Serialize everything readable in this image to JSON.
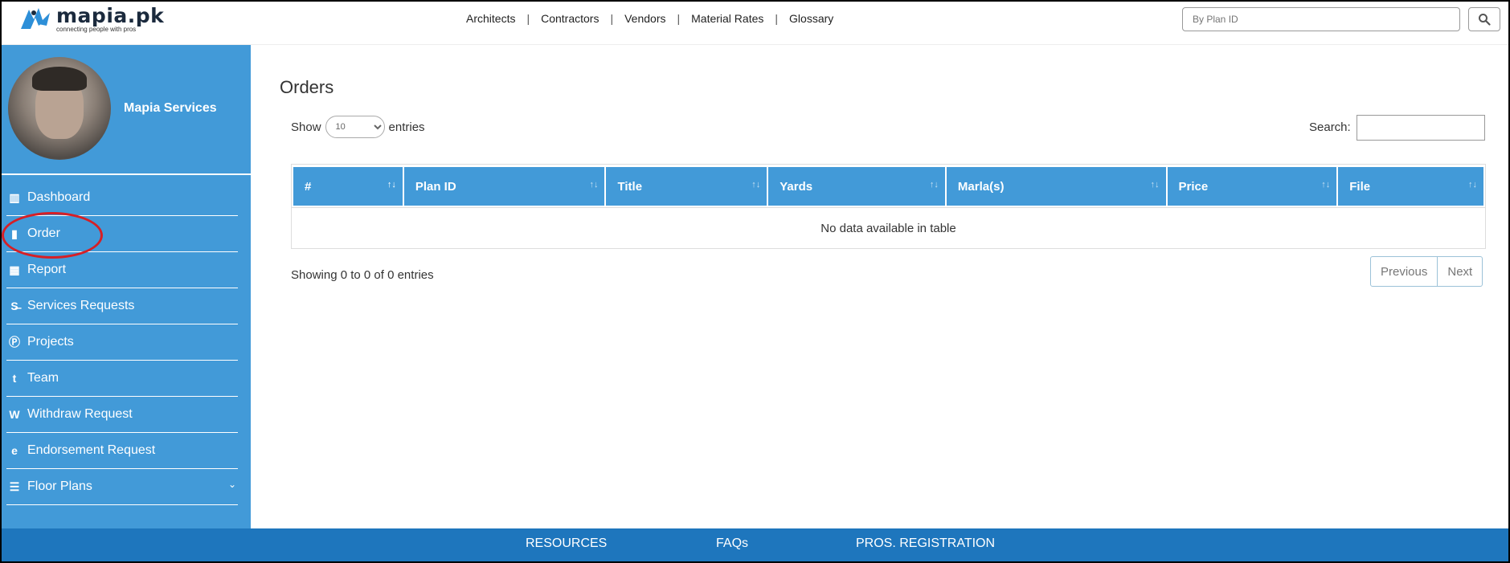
{
  "brand": {
    "name": "mapia.pk",
    "tagline": "connecting people with pros"
  },
  "nav": [
    "Architects",
    "Contractors",
    "Vendors",
    "Material Rates",
    "Glossary"
  ],
  "nav_separator": "|",
  "top_search": {
    "placeholder": "By Plan ID"
  },
  "profile": {
    "name": "Mapia Services"
  },
  "sidebar": [
    {
      "label": "Dashboard",
      "icon": "bar-chart-icon",
      "glyph": "▥"
    },
    {
      "label": "Order",
      "icon": "file-icon",
      "glyph": "▮"
    },
    {
      "label": "Report",
      "icon": "calendar-icon",
      "glyph": "▦"
    },
    {
      "label": "Services Requests",
      "icon": "strikethrough-icon",
      "glyph": "S̶"
    },
    {
      "label": "Projects",
      "icon": "p-circle-icon",
      "glyph": "Ⓟ"
    },
    {
      "label": "Team",
      "icon": "tumblr-icon",
      "glyph": "t"
    },
    {
      "label": "Withdraw Request",
      "icon": "wikipedia-icon",
      "glyph": "W"
    },
    {
      "label": "Endorsement Request",
      "icon": "edge-icon",
      "glyph": "e"
    },
    {
      "label": "Floor Plans",
      "icon": "table-icon",
      "glyph": "☰"
    }
  ],
  "floor_plans_caret": "⌄",
  "page_title": "Orders",
  "show": {
    "prefix": "Show",
    "value": "10",
    "suffix": "entries"
  },
  "table_search_label": "Search:",
  "columns": [
    {
      "label": "#",
      "sort": "↑↓"
    },
    {
      "label": "Plan ID",
      "sort": "↑↓"
    },
    {
      "label": "Title",
      "sort": "↑↓"
    },
    {
      "label": "Yards",
      "sort": "↑↓"
    },
    {
      "label": "Marla(s)",
      "sort": "↑↓"
    },
    {
      "label": "Price",
      "sort": "↑↓"
    },
    {
      "label": "File",
      "sort": "↑↓"
    }
  ],
  "empty_message": "No data available in table",
  "info": "Showing 0 to 0 of 0 entries",
  "pager": {
    "previous": "Previous",
    "next": "Next"
  },
  "footer": [
    "RESOURCES",
    "FAQs",
    "PROS. REGISTRATION"
  ],
  "colors": {
    "primary": "#429ad8",
    "footer": "#1e76bd",
    "annotation": "#d61f26"
  }
}
